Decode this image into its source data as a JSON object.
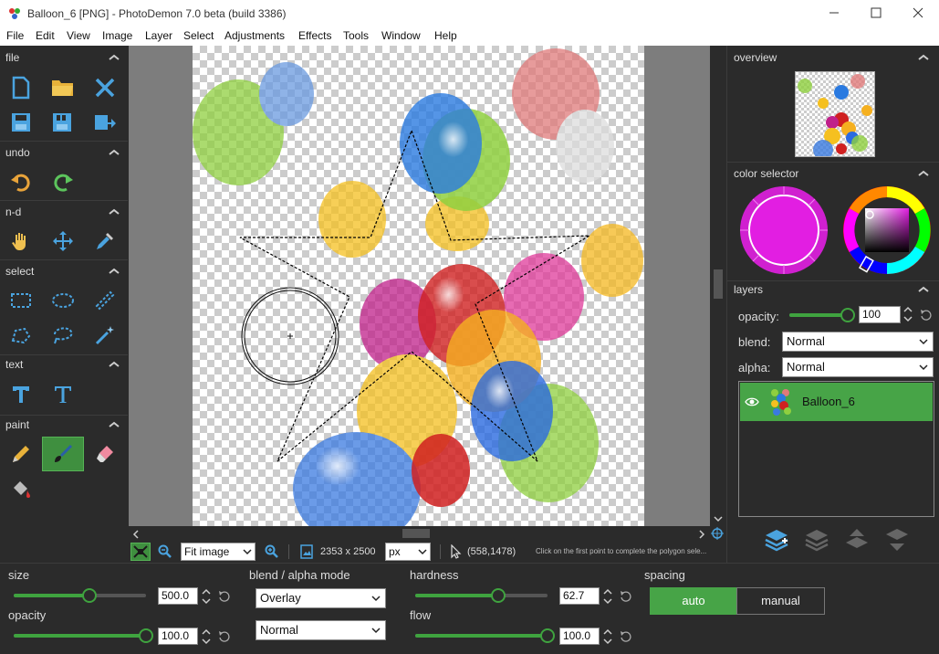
{
  "window": {
    "title": "Balloon_6 [PNG]  -  PhotoDemon 7.0 beta (build 3386)",
    "controls": [
      "minimize-icon",
      "maximize-icon",
      "close-icon"
    ]
  },
  "menu": [
    "File",
    "Edit",
    "View",
    "Image",
    "Layer",
    "Select",
    "Adjustments",
    "Effects",
    "Tools",
    "Window",
    "Help"
  ],
  "toolbox": {
    "sections": {
      "file": "file",
      "undo": "undo",
      "nd": "n-d",
      "select": "select",
      "text": "text",
      "paint": "paint"
    }
  },
  "status": {
    "zoom_option": "Fit image",
    "image_size": "2353 x 2500",
    "unit": "px",
    "cursor_pos": "(558,1478)",
    "message": "Click on the first point to complete the polygon sele..."
  },
  "right_panel": {
    "overview": "overview",
    "color_selector": "color selector",
    "primary_color": "#e21ee2",
    "layers": {
      "title": "layers",
      "opacity_label": "opacity:",
      "opacity_value": "100",
      "opacity_fraction": 1.0,
      "blend_label": "blend:",
      "blend_value": "Normal",
      "alpha_label": "alpha:",
      "alpha_value": "Normal",
      "layer_name": "Balloon_6"
    }
  },
  "options": {
    "size_label": "size",
    "size_value": "500.0",
    "size_fraction": 0.57,
    "opacity_label": "opacity",
    "opacity_value": "100.0",
    "opacity_fraction": 1.0,
    "blend_label": "blend / alpha mode",
    "blend_value": "Overlay",
    "alpha_value": "Normal",
    "hardness_label": "hardness",
    "hardness_value": "62.7",
    "hardness_fraction": 0.627,
    "flow_label": "flow",
    "flow_value": "100.0",
    "flow_fraction": 1.0,
    "spacing_label": "spacing",
    "spacing_auto": "auto",
    "spacing_manual": "manual"
  },
  "colors": {
    "accent": "#3fa33f",
    "panel_bg": "#2b2b2b",
    "canvas_bg": "#7d7d7d"
  }
}
